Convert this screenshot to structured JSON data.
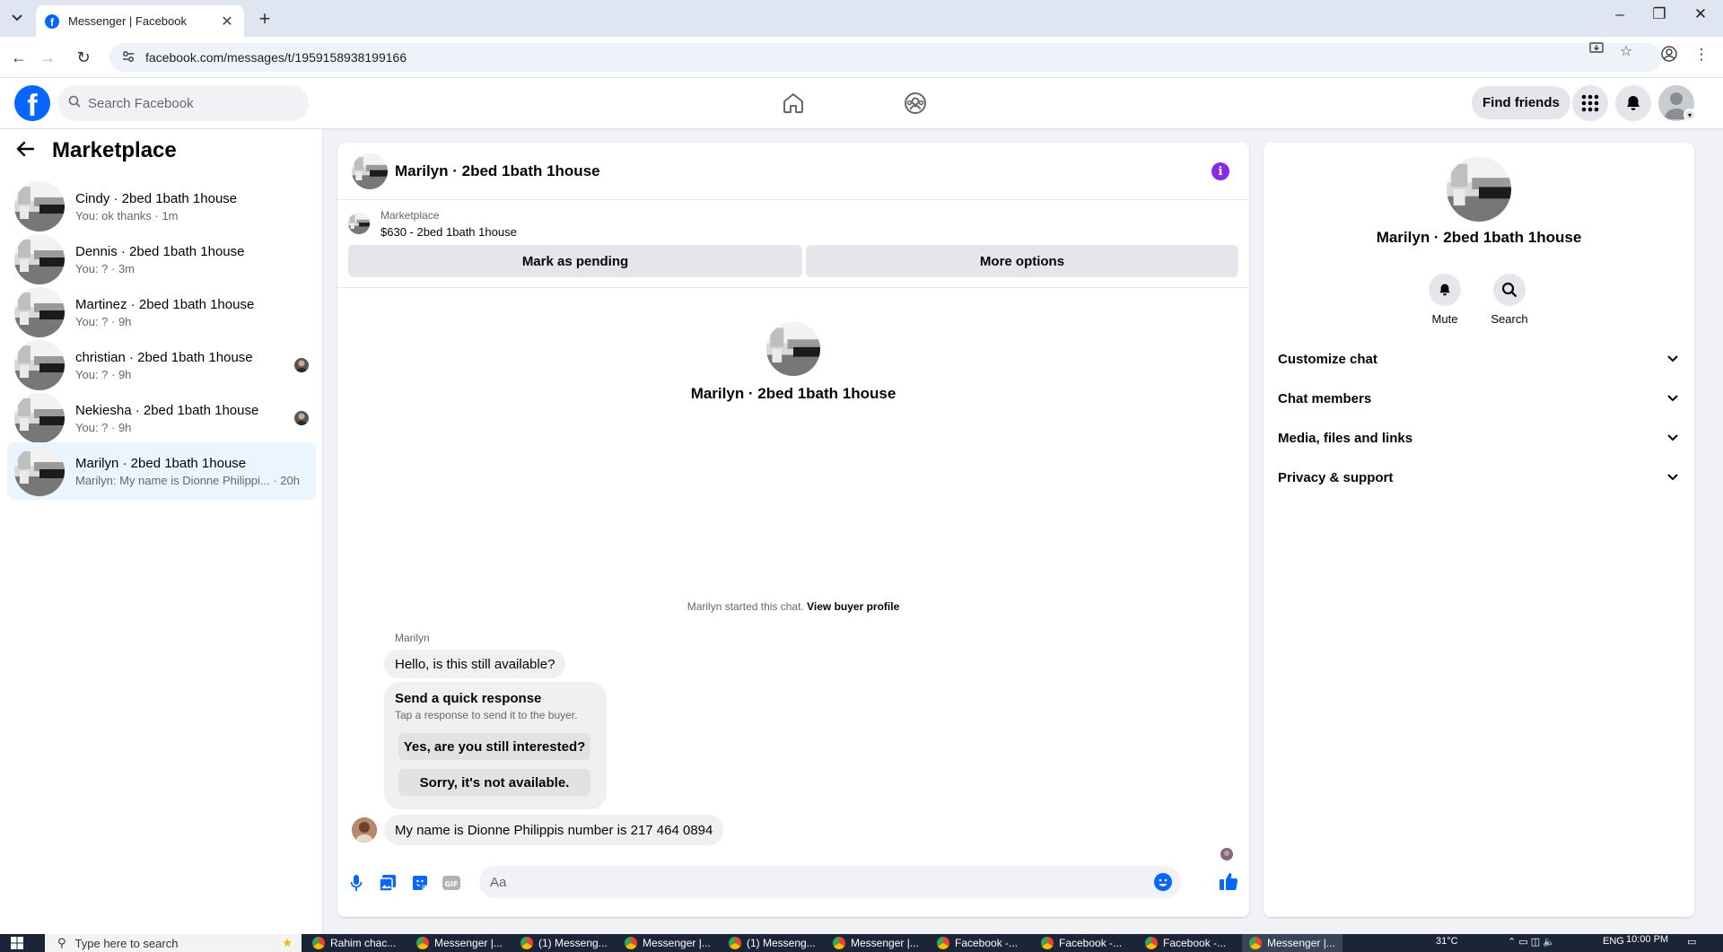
{
  "browser": {
    "tab_title": "Messenger | Facebook",
    "tab_close": "✕",
    "new_tab": "+",
    "url": "facebook.com/messages/t/1959158938199166"
  },
  "header": {
    "logo": "f",
    "search_placeholder": "Search Facebook",
    "find_friends": "Find friends"
  },
  "sidebar": {
    "title": "Marketplace",
    "conversations": [
      {
        "name": "Cindy · 2bed 1bath 1house",
        "preview": "You: ok thanks · 1m",
        "active": false,
        "seen": false
      },
      {
        "name": "Dennis · 2bed 1bath 1house",
        "preview": "You: ? · 3m",
        "active": false,
        "seen": false
      },
      {
        "name": "Martinez · 2bed 1bath 1house",
        "preview": "You: ? · 9h",
        "active": false,
        "seen": false
      },
      {
        "name": "christian · 2bed 1bath 1house",
        "preview": "You: ? · 9h",
        "active": false,
        "seen": true
      },
      {
        "name": "Nekiesha · 2bed 1bath 1house",
        "preview": "You: ? · 9h",
        "active": false,
        "seen": true
      },
      {
        "name": "Marilyn · 2bed 1bath 1house",
        "preview": "Marilyn: My name is Dionne Philippi... · 20h",
        "active": true,
        "seen": false
      }
    ]
  },
  "chat": {
    "title": "Marilyn · 2bed 1bath 1house",
    "info_icon": "i",
    "listing_source": "Marketplace",
    "listing_price_title": "$630 - 2bed 1bath 1house",
    "mark_pending": "Mark as pending",
    "more_options": "More options",
    "intro_name": "Marilyn · 2bed 1bath 1house",
    "started_text": "Marilyn started this chat.",
    "view_buyer_profile": "View buyer profile",
    "sender_name": "Marilyn",
    "message_1": "Hello, is this still available?",
    "quick_response_title": "Send a quick response",
    "quick_response_sub": "Tap a response to send it to the buyer.",
    "quick_reply_1": "Yes, are you still interested?",
    "quick_reply_2": "Sorry, it's not available.",
    "message_2": "My name is  Dionne Philippis number is 217 464 0894",
    "composer_placeholder": "Aa"
  },
  "info_panel": {
    "name": "Marilyn · 2bed 1bath 1house",
    "mute": "Mute",
    "search": "Search",
    "sections": [
      "Customize chat",
      "Chat members",
      "Media, files and links",
      "Privacy & support"
    ]
  },
  "taskbar": {
    "search_placeholder": "Type here to search",
    "apps": [
      "Rahim chac...",
      "Messenger |...",
      "(1) Messeng...",
      "Messenger |...",
      "(1) Messeng...",
      "Messenger |...",
      "Facebook -...",
      "Facebook -...",
      "Facebook -...",
      "Messenger |..."
    ],
    "temperature": "31°C",
    "language": "ENG",
    "time": "10:00 PM"
  },
  "colors": {
    "brand": "#0866ff",
    "active_conversation": "#ebf5ff",
    "info_accent": "#8a2be2"
  }
}
